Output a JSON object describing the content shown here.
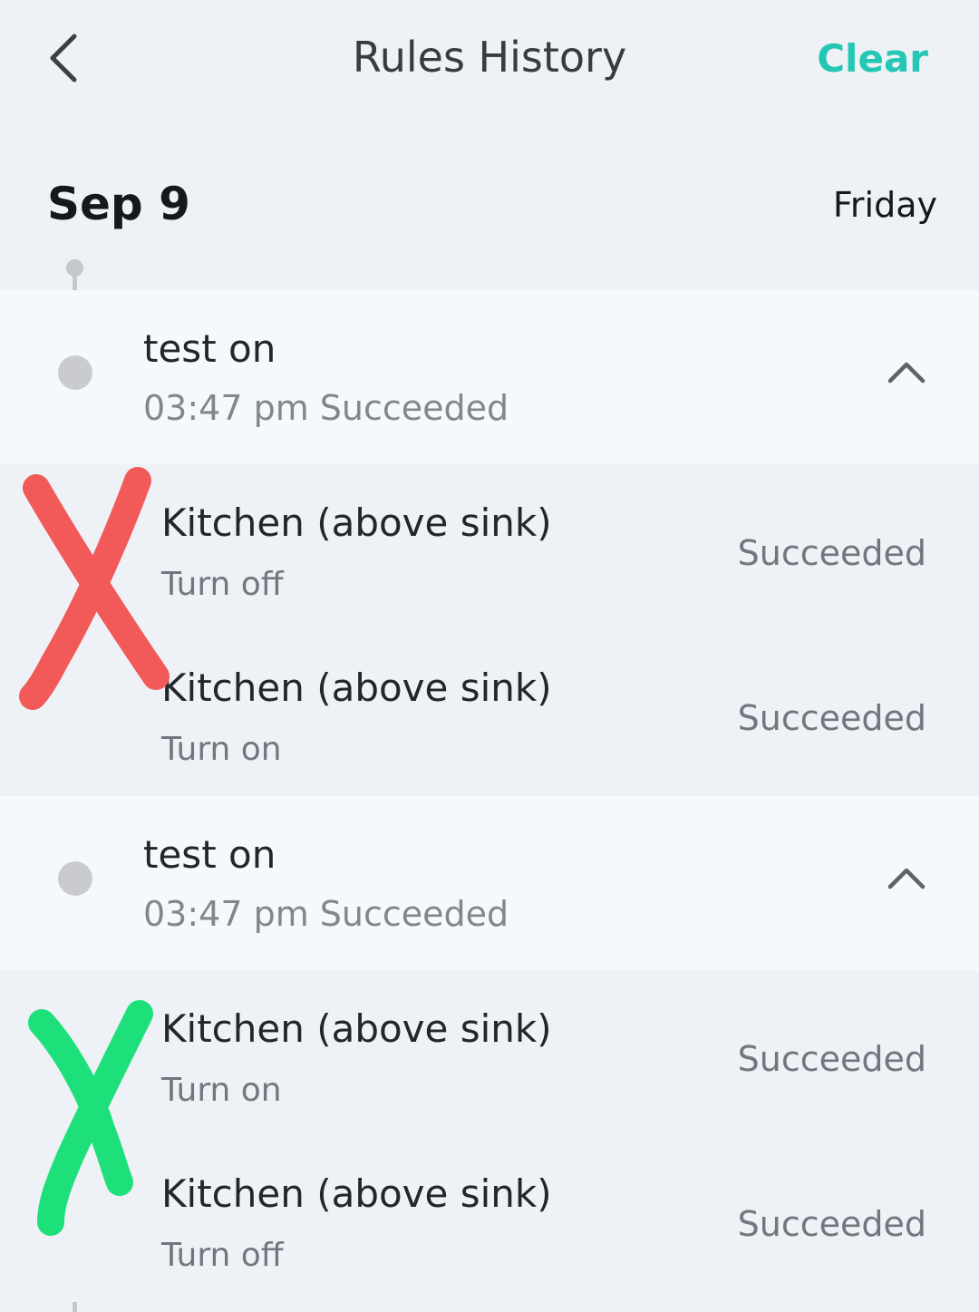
{
  "header": {
    "title": "Rules History",
    "clear_label": "Clear",
    "back_icon": "chevron-left-icon"
  },
  "date_group": {
    "date": "Sep 9",
    "weekday": "Friday"
  },
  "rules": [
    {
      "name": "test on",
      "meta": "03:47 pm Succeeded",
      "expanded": true,
      "actions": [
        {
          "device": "Kitchen (above sink)",
          "command": "Turn off",
          "status": "Succeeded"
        },
        {
          "device": "Kitchen (above sink)",
          "command": "Turn on",
          "status": "Succeeded"
        }
      ]
    },
    {
      "name": "test on",
      "meta": "03:47 pm Succeeded",
      "expanded": true,
      "actions": [
        {
          "device": "Kitchen (above sink)",
          "command": "Turn on",
          "status": "Succeeded"
        },
        {
          "device": "Kitchen (above sink)",
          "command": "Turn off",
          "status": "Succeeded"
        }
      ]
    }
  ],
  "colors": {
    "accent": "#23c7b3",
    "annotation_red": "#f25a5a",
    "annotation_green": "#1ee07a"
  }
}
